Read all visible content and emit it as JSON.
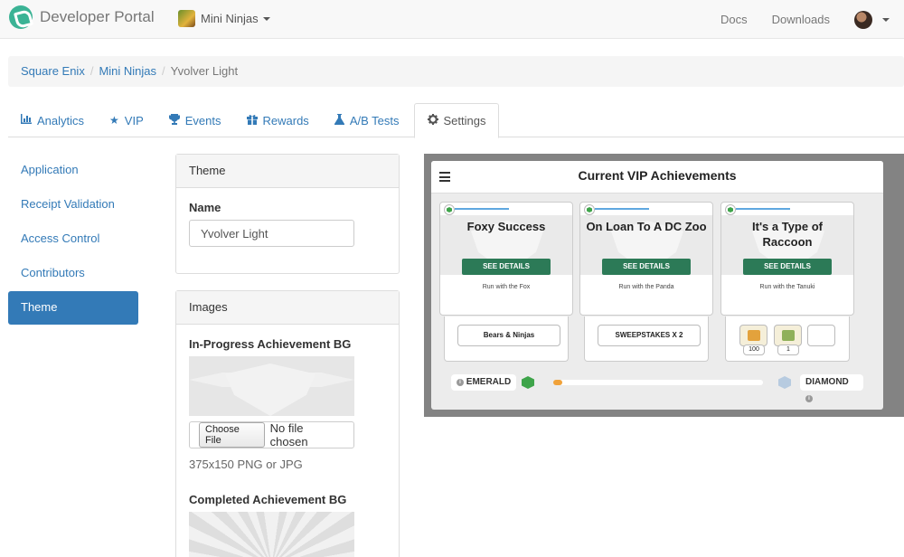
{
  "navbar": {
    "brand": "Developer Portal",
    "app_selector": "Mini Ninjas",
    "links": [
      "Docs",
      "Downloads"
    ]
  },
  "breadcrumb": [
    "Square Enix",
    "Mini Ninjas",
    "Yvolver Light"
  ],
  "tabs": [
    {
      "label": "Analytics",
      "icon": "bar-chart-icon"
    },
    {
      "label": "VIP",
      "icon": "star-icon"
    },
    {
      "label": "Events",
      "icon": "trophy-icon"
    },
    {
      "label": "Rewards",
      "icon": "gift-icon"
    },
    {
      "label": "A/B Tests",
      "icon": "flask-icon"
    },
    {
      "label": "Settings",
      "icon": "gear-icon",
      "active": true
    }
  ],
  "sidebar": {
    "items": [
      "Application",
      "Receipt Validation",
      "Access Control",
      "Contributors",
      "Theme"
    ],
    "active": "Theme"
  },
  "theme_panel": {
    "heading": "Theme",
    "name_label": "Name",
    "name_value": "Yvolver Light"
  },
  "images_panel": {
    "heading": "Images",
    "in_progress_label": "In-Progress Achievement BG",
    "choose_file": "Choose File",
    "no_file": "No file chosen",
    "help": "375x150 PNG or JPG",
    "completed_label": "Completed Achievement BG"
  },
  "preview": {
    "title": "Current VIP Achievements",
    "achievements": [
      {
        "title": "Foxy Success",
        "button": "SEE DETAILS",
        "desc": "Run with the Fox",
        "reward": "Bears & Ninjas"
      },
      {
        "title": "On Loan To A DC Zoo",
        "button": "SEE DETAILS",
        "desc": "Run with the Panda",
        "reward": "SWEEPSTAKES X 2"
      },
      {
        "title": "It's a Type of Raccoon",
        "button": "SEE DETAILS",
        "desc": "Run with the Tanuki",
        "reward_items": [
          {
            "count": "100"
          },
          {
            "count": "1"
          }
        ]
      }
    ],
    "tier_current": "EMERALD",
    "tier_next": "DIAMOND",
    "tier_progress": 0.04,
    "info_glyph": "i"
  },
  "colors": {
    "link": "#337ab7",
    "active_nav": "#337ab7",
    "see_details": "#2c7a57",
    "progress": "#f0a23a",
    "brand_logo": "#3bb395"
  }
}
